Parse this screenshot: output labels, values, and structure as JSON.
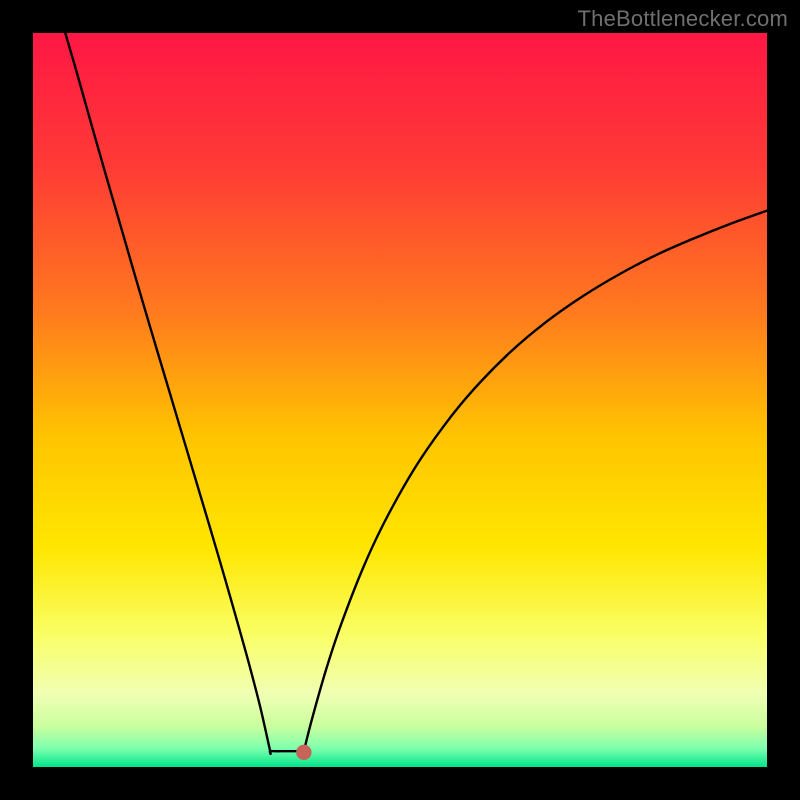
{
  "attribution": "TheBottlenecker.com",
  "colors": {
    "frame": "#000000",
    "curve": "#000000",
    "marker": "#c8635a"
  },
  "chart_data": {
    "type": "line",
    "title": "",
    "xlabel": "",
    "ylabel": "",
    "xlim": [
      0,
      100
    ],
    "ylim": [
      0,
      100
    ],
    "grid": false,
    "legend": false,
    "gradient_stops": [
      {
        "offset": 0.0,
        "color": "#ff1744"
      },
      {
        "offset": 0.18,
        "color": "#ff3a36"
      },
      {
        "offset": 0.38,
        "color": "#ff7a1e"
      },
      {
        "offset": 0.55,
        "color": "#ffc400"
      },
      {
        "offset": 0.7,
        "color": "#ffe600"
      },
      {
        "offset": 0.82,
        "color": "#faff66"
      },
      {
        "offset": 0.9,
        "color": "#f1ffb3"
      },
      {
        "offset": 0.945,
        "color": "#c9ff9e"
      },
      {
        "offset": 0.975,
        "color": "#7dffad"
      },
      {
        "offset": 1.0,
        "color": "#00e58a"
      }
    ],
    "series": [
      {
        "name": "left-branch",
        "x": [
          4.4,
          6,
          8,
          10,
          12,
          14,
          16,
          18,
          20,
          22,
          24,
          26,
          28,
          29.5,
          31,
          32.3
        ],
        "y": [
          100,
          94.5,
          87.4,
          80.4,
          73.5,
          66.6,
          59.8,
          53.1,
          46.4,
          39.7,
          33.0,
          26.2,
          19.2,
          13.8,
          8.0,
          2.2
        ]
      },
      {
        "name": "valley-floor",
        "x": [
          32.3,
          33.0,
          34.2,
          35.6,
          36.9
        ],
        "y": [
          2.2,
          2.15,
          2.15,
          2.15,
          2.15
        ]
      },
      {
        "name": "right-branch",
        "x": [
          36.9,
          38,
          40,
          42,
          45,
          48,
          52,
          56,
          60,
          65,
          70,
          75,
          80,
          85,
          90,
          95,
          100
        ],
        "y": [
          2.15,
          6.5,
          13.5,
          19.5,
          27.2,
          33.6,
          40.7,
          46.5,
          51.4,
          56.5,
          60.7,
          64.2,
          67.2,
          69.8,
          72.0,
          74.0,
          75.8
        ]
      }
    ],
    "marker": {
      "x": 36.9,
      "y": 2.0,
      "r": 1.05
    }
  }
}
